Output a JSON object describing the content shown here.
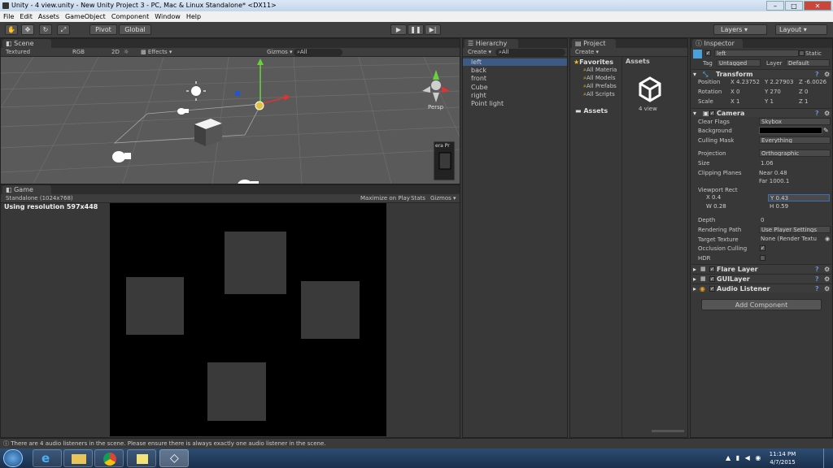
{
  "title_bar": {
    "text": "Unity - 4 view.unity - New Unity Project 3 - PC, Mac & Linux Standalone* <DX11>"
  },
  "window_controls": {
    "minimize": "–",
    "maximize": "□",
    "close": "✕"
  },
  "menu": [
    "File",
    "Edit",
    "Assets",
    "GameObject",
    "Component",
    "Window",
    "Help"
  ],
  "toolbar": {
    "pivot": "Pivot",
    "global": "Global",
    "layers": "Layers",
    "layout": "Layout"
  },
  "scene": {
    "tab": "Scene",
    "shading": "Textured",
    "render": "RGB",
    "mode2d": "2D",
    "effects": "Effects",
    "gizmos": "Gizmos",
    "search": "All",
    "persp": "Persp",
    "camera_preview_label": "era Pr"
  },
  "game": {
    "tab": "Game",
    "resolution": "Standalone (1024x768)",
    "maximize": "Maximize on Play",
    "stats": "Stats",
    "gizmos": "Gizmos",
    "using_resolution": "Using resolution 597x448"
  },
  "hierarchy": {
    "tab": "Hierarchy",
    "create": "Create",
    "search": "All",
    "items": [
      "left",
      "back",
      "front",
      "Cube",
      "right",
      "Point light"
    ]
  },
  "project": {
    "tab": "Project",
    "create": "Create",
    "favorites": "Favorites",
    "fav_items": [
      "All Materia",
      "All Models",
      "All Prefabs",
      "All Scripts"
    ],
    "assets_folder": "Assets",
    "assets_header": "Assets",
    "asset_name": "4 view"
  },
  "inspector": {
    "tab": "Inspector",
    "object_name": "left",
    "static": "Static",
    "tag_label": "Tag",
    "tag_value": "Untagged",
    "layer_label": "Layer",
    "layer_value": "Default",
    "transform": {
      "title": "Transform",
      "position_label": "Position",
      "pos_x": "X 4.23752",
      "pos_y": "Y 2.27903",
      "pos_z": "Z -6.0026",
      "rotation_label": "Rotation",
      "rot_x": "X 0",
      "rot_y": "Y 270",
      "rot_z": "Z 0",
      "scale_label": "Scale",
      "scl_x": "X 1",
      "scl_y": "Y 1",
      "scl_z": "Z 1"
    },
    "camera": {
      "title": "Camera",
      "clear_flags_label": "Clear Flags",
      "clear_flags": "Skybox",
      "background_label": "Background",
      "culling_mask_label": "Culling Mask",
      "culling_mask": "Everything",
      "projection_label": "Projection",
      "projection": "Orthographic",
      "size_label": "Size",
      "size": "1.06",
      "clipping_label": "Clipping Planes",
      "near": "Near 0.48",
      "far": "Far  1000.1",
      "viewport_label": "Viewport Rect",
      "vp_x": "X 0.4",
      "vp_y": "Y 0.43",
      "vp_w": "W 0.28",
      "vp_h": "H 0.59",
      "depth_label": "Depth",
      "depth": "0",
      "rendering_path_label": "Rendering Path",
      "rendering_path": "Use Player Settings",
      "target_texture_label": "Target Texture",
      "target_texture": "None (Render Textu",
      "occlusion_label": "Occlusion Culling",
      "hdr_label": "HDR"
    },
    "flare_layer": "Flare Layer",
    "gui_layer": "GUILayer",
    "audio_listener": "Audio Listener",
    "add_component": "Add Component"
  },
  "status_bar": {
    "message": "There are 4 audio listeners in the scene. Please ensure there is always exactly one audio listener in the scene."
  },
  "taskbar": {
    "time": "11:14 PM",
    "date": "4/7/2015"
  },
  "colors": {
    "accent": "#3d5a85",
    "titlebar": "#c3d5ea",
    "taskbar": "#1f3a5c"
  }
}
